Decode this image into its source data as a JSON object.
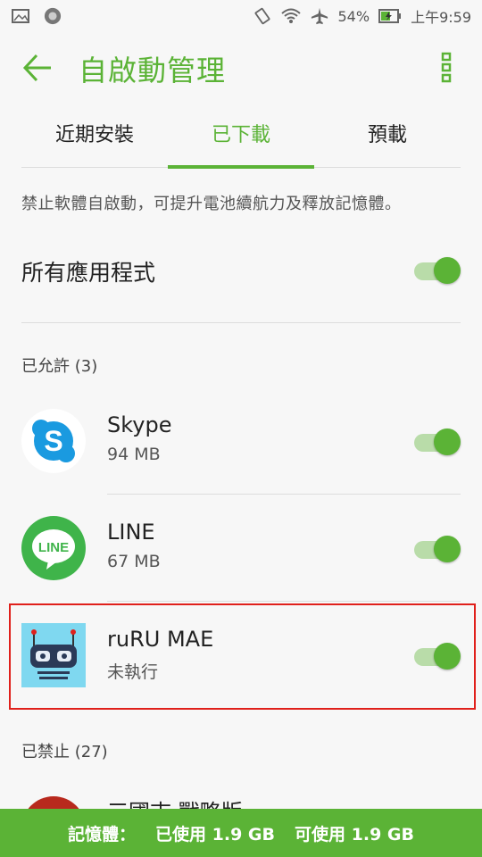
{
  "status": {
    "battery": "54%",
    "time": "上午9:59"
  },
  "header": {
    "title": "自啟動管理"
  },
  "tabs": [
    {
      "label": "近期安裝",
      "active": false
    },
    {
      "label": "已下載",
      "active": true
    },
    {
      "label": "預載",
      "active": false
    }
  ],
  "description": "禁止軟體自啟動，可提升電池續航力及釋放記憶體。",
  "all_apps": {
    "label": "所有應用程式",
    "enabled": true
  },
  "allowed": {
    "heading": "已允許 (3)",
    "apps": [
      {
        "name": "Skype",
        "detail": "94 MB",
        "icon": "skype-icon",
        "enabled": true
      },
      {
        "name": "LINE",
        "detail": "67 MB",
        "icon": "line-icon",
        "enabled": true
      },
      {
        "name": "ruRU MAE",
        "detail": "未執行",
        "icon": "robot-icon",
        "enabled": true
      }
    ]
  },
  "blocked": {
    "heading": "已禁止 (27)",
    "first_app_name": "三國志 戰略版"
  },
  "memory": {
    "label": "記憶體：",
    "used_label": "已使用",
    "used_value": "1.9 GB",
    "available_label": "可使用",
    "available_value": "1.9 GB"
  },
  "colors": {
    "accent": "#5bb336",
    "highlight_border": "#e0201b"
  }
}
